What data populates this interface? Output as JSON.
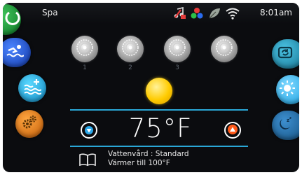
{
  "status_bar": {
    "title": "Spa",
    "time": "8:01am",
    "icons": [
      "music-muted-icon",
      "color-wheel-icon",
      "leaf-icon",
      "wifi-icon"
    ]
  },
  "left_buttons": [
    {
      "name": "home-icon",
      "color": "#1ea43a"
    },
    {
      "name": "swimmer-icon",
      "color": "#1f4fd0"
    },
    {
      "name": "water-temp-plus-icon",
      "color": "#19a8e8"
    },
    {
      "name": "settings-gears-icon",
      "color": "#e07a10"
    }
  ],
  "right_buttons": [
    {
      "name": "refresh-icon",
      "color": "#1d8fb4"
    },
    {
      "name": "brightness-icon",
      "color": "#2ab6f0"
    },
    {
      "name": "sleep-icon",
      "color": "#2374b0"
    }
  ],
  "jets": [
    {
      "label": "1",
      "icon": "jet-icon"
    },
    {
      "label": "2",
      "icon": "jet-icon"
    },
    {
      "label": "3",
      "icon": "jet-icon"
    },
    {
      "label": "",
      "icon": "jet-icon"
    }
  ],
  "light": {
    "icon": "light-icon",
    "color": "#ffd21a"
  },
  "temperature": {
    "value": "75°F",
    "down_icon": "temp-down-icon",
    "up_icon": "temp-up-icon"
  },
  "info": {
    "line1": "Vattenvård : Standard",
    "line2": "Värmer till 100°F",
    "icon": "book-icon"
  },
  "colors": {
    "accent": "#2aa7d6",
    "background": "#0b0c0f"
  }
}
